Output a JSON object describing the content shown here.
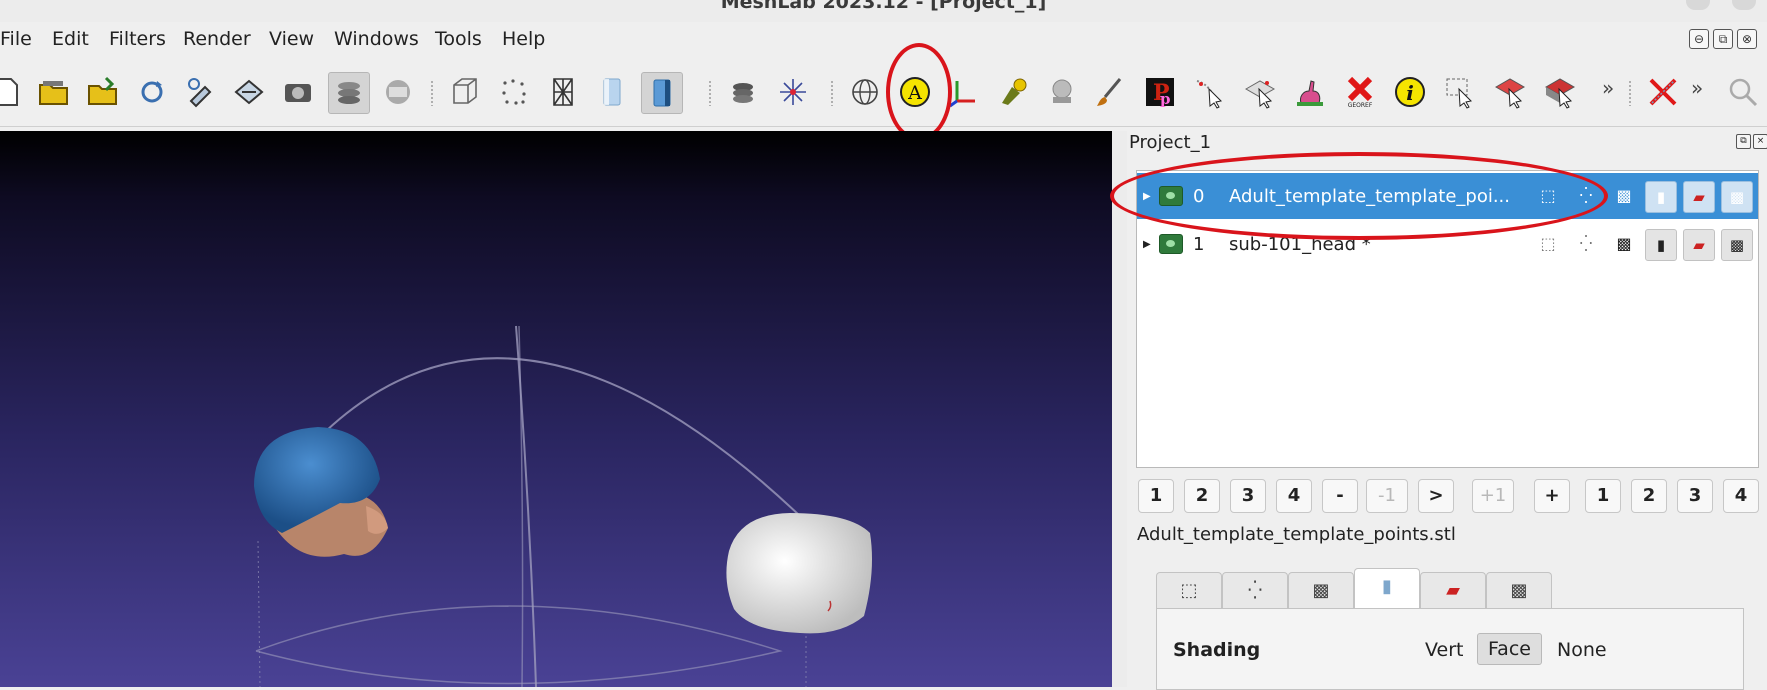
{
  "window": {
    "title": "MeshLab 2023.12 - [Project_1]"
  },
  "menu": [
    "File",
    "Edit",
    "Filters",
    "Render",
    "View",
    "Windows",
    "Tools",
    "Help"
  ],
  "mdi_controls": [
    "⊖",
    "⧉",
    "⊗"
  ],
  "toolbar": {
    "icons": [
      "new-project-icon",
      "open-project-icon",
      "import-mesh-icon",
      "reload-icon",
      "reload-all-icon",
      "export-mesh-icon",
      "snapshot-icon",
      "layer-dialog-icon",
      "raster-layer-icon",
      "bbox-render-icon",
      "points-render-icon",
      "wireframe-render-icon",
      "flat-render-icon",
      "smooth-render-icon",
      "light-icon",
      "axes-icon",
      "trackball-icon",
      "annotation-a-icon",
      "axis-plot-icon",
      "paint-selection-icon",
      "camera-icon",
      "brush-icon",
      "pick-points-icon",
      "select-vertices-icon",
      "select-faces-icon",
      "bunny-icon",
      "georef-icon",
      "info-icon",
      "select-region-icon",
      "select-faces-brush-icon",
      "select-connected-icon",
      "cancel-red-x-icon",
      "search-icon"
    ],
    "overflow": "»",
    "georef_label": "GEOREF"
  },
  "panel": {
    "title": "Project_1",
    "layers": [
      {
        "index": "0",
        "name": "Adult_template_template_poi...",
        "selected": true
      },
      {
        "index": "1",
        "name": "sub-101_head *",
        "selected": false
      }
    ],
    "pager": [
      "1",
      "2",
      "3",
      "4",
      "-",
      "-1",
      ">",
      "+1",
      "+",
      "1",
      "2",
      "3",
      "4"
    ],
    "current_file": "Adult_template_template_points.stl",
    "tabs": [
      "bbox",
      "points",
      "wire",
      "fill",
      "texture",
      "color"
    ],
    "shading": {
      "label": "Shading",
      "options": [
        "Vert",
        "Face",
        "None"
      ],
      "selected": "Face"
    }
  },
  "colors": {
    "selection": "#3a8fd6",
    "annotation": "#d9141b"
  }
}
